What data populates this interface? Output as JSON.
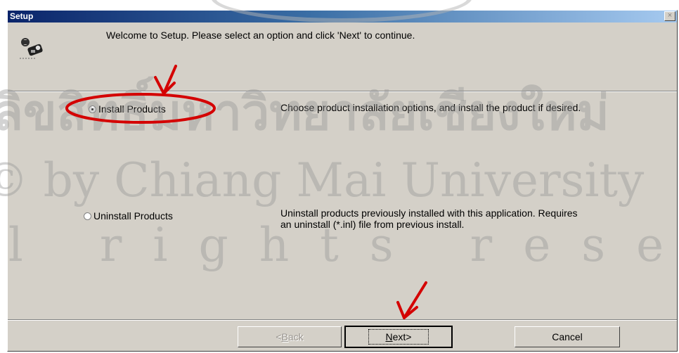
{
  "window": {
    "title": "Setup",
    "close_glyph": "×"
  },
  "welcome_text": "Welcome to Setup.  Please select an option and click 'Next' to continue.",
  "options": [
    {
      "label": "Install Products",
      "selected": true,
      "description": "Choose product installation options, and install the product if desired."
    },
    {
      "label": "Uninstall Products",
      "selected": false,
      "description": "Uninstall products previously installed with this application.  Requires an uninstall (*.inl) file from previous install."
    }
  ],
  "buttons": {
    "back_prefix": "<",
    "back_mnemonic": "B",
    "back_rest": "ack",
    "next_mnemonic": "N",
    "next_rest": "ext>",
    "cancel": "Cancel"
  },
  "watermark": {
    "line1": "ลิขสิทธิ์มหาวิทยาลัยเชียงใหม่",
    "line2": "Copyright © by Chiang Mai University",
    "line3": "All rights reserved"
  },
  "icons": {
    "app_icon": "setup-app-icon",
    "close": "close-icon"
  },
  "colors": {
    "dialog_bg": "#d4d0c8",
    "title_bar_start": "#0a246a",
    "title_bar_end": "#a6caf0",
    "annotation_red": "#d40000"
  }
}
